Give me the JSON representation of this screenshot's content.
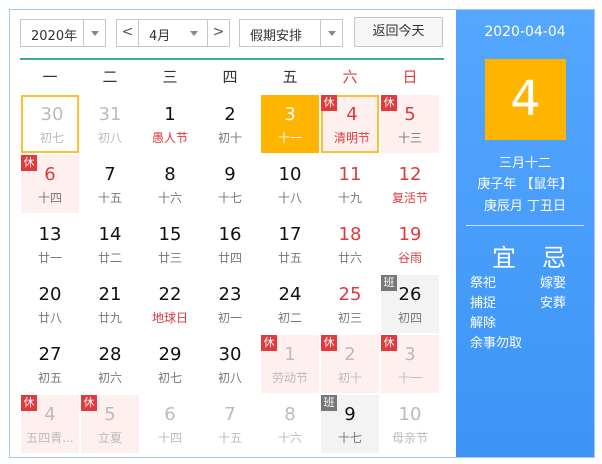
{
  "toolbar": {
    "year": "2020年",
    "month": "4月",
    "prev": "<",
    "next": ">",
    "holiday_select": "假期安排",
    "today_button": "返回今天"
  },
  "weekdays": [
    "一",
    "二",
    "三",
    "四",
    "五",
    "六",
    "日"
  ],
  "weeks": [
    [
      {
        "num": "30",
        "lunar": "初七",
        "state": "other today"
      },
      {
        "num": "31",
        "lunar": "初八",
        "state": "other"
      },
      {
        "num": "1",
        "lunar": "愚人节",
        "state": "fest"
      },
      {
        "num": "2",
        "lunar": "初十",
        "state": ""
      },
      {
        "num": "3",
        "lunar": "十一",
        "state": "selected"
      },
      {
        "num": "4",
        "lunar": "清明节",
        "state": "wkend fest holiday today",
        "badge": "休"
      },
      {
        "num": "5",
        "lunar": "十三",
        "state": "wkend holiday",
        "badge": "休"
      }
    ],
    [
      {
        "num": "6",
        "lunar": "十四",
        "state": "wkend holiday",
        "badge": "休"
      },
      {
        "num": "7",
        "lunar": "十五",
        "state": ""
      },
      {
        "num": "8",
        "lunar": "十六",
        "state": ""
      },
      {
        "num": "9",
        "lunar": "十七",
        "state": ""
      },
      {
        "num": "10",
        "lunar": "十八",
        "state": ""
      },
      {
        "num": "11",
        "lunar": "十九",
        "state": "wkend"
      },
      {
        "num": "12",
        "lunar": "复活节",
        "state": "wkend fest"
      }
    ],
    [
      {
        "num": "13",
        "lunar": "廿一",
        "state": ""
      },
      {
        "num": "14",
        "lunar": "廿二",
        "state": ""
      },
      {
        "num": "15",
        "lunar": "廿三",
        "state": ""
      },
      {
        "num": "16",
        "lunar": "廿四",
        "state": ""
      },
      {
        "num": "17",
        "lunar": "廿五",
        "state": ""
      },
      {
        "num": "18",
        "lunar": "廿六",
        "state": "wkend"
      },
      {
        "num": "19",
        "lunar": "谷雨",
        "state": "wkend fest"
      }
    ],
    [
      {
        "num": "20",
        "lunar": "廿八",
        "state": ""
      },
      {
        "num": "21",
        "lunar": "廿九",
        "state": ""
      },
      {
        "num": "22",
        "lunar": "地球日",
        "state": "fest"
      },
      {
        "num": "23",
        "lunar": "初一",
        "state": ""
      },
      {
        "num": "24",
        "lunar": "初二",
        "state": ""
      },
      {
        "num": "25",
        "lunar": "初三",
        "state": "wkend"
      },
      {
        "num": "26",
        "lunar": "初四",
        "state": "workday",
        "badge": "班"
      }
    ],
    [
      {
        "num": "27",
        "lunar": "初五",
        "state": ""
      },
      {
        "num": "28",
        "lunar": "初六",
        "state": ""
      },
      {
        "num": "29",
        "lunar": "初七",
        "state": ""
      },
      {
        "num": "30",
        "lunar": "初八",
        "state": ""
      },
      {
        "num": "1",
        "lunar": "劳动节",
        "state": "other holiday",
        "badge": "休"
      },
      {
        "num": "2",
        "lunar": "初十",
        "state": "other holiday",
        "badge": "休"
      },
      {
        "num": "3",
        "lunar": "十一",
        "state": "other holiday",
        "badge": "休"
      }
    ],
    [
      {
        "num": "4",
        "lunar": "五四青...",
        "state": "other holiday",
        "badge": "休"
      },
      {
        "num": "5",
        "lunar": "立夏",
        "state": "other holiday",
        "badge": "休"
      },
      {
        "num": "6",
        "lunar": "十四",
        "state": "other"
      },
      {
        "num": "7",
        "lunar": "十五",
        "state": "other"
      },
      {
        "num": "8",
        "lunar": "十六",
        "state": "other"
      },
      {
        "num": "9",
        "lunar": "十七",
        "state": "workday",
        "badge": "班"
      },
      {
        "num": "10",
        "lunar": "母亲节",
        "state": "other"
      }
    ]
  ],
  "panel": {
    "date": "2020-04-04",
    "day": "4",
    "lunar_date": "三月十二",
    "year_ganzhi": "庚子年 【鼠年】",
    "month_day_ganzhi": "庚辰月 丁丑日",
    "yi_title": "宜",
    "ji_title": "忌",
    "yi": [
      "祭祀",
      "捕捉",
      "解除",
      "余事勿取"
    ],
    "ji": [
      "嫁娶",
      "安葬"
    ]
  }
}
